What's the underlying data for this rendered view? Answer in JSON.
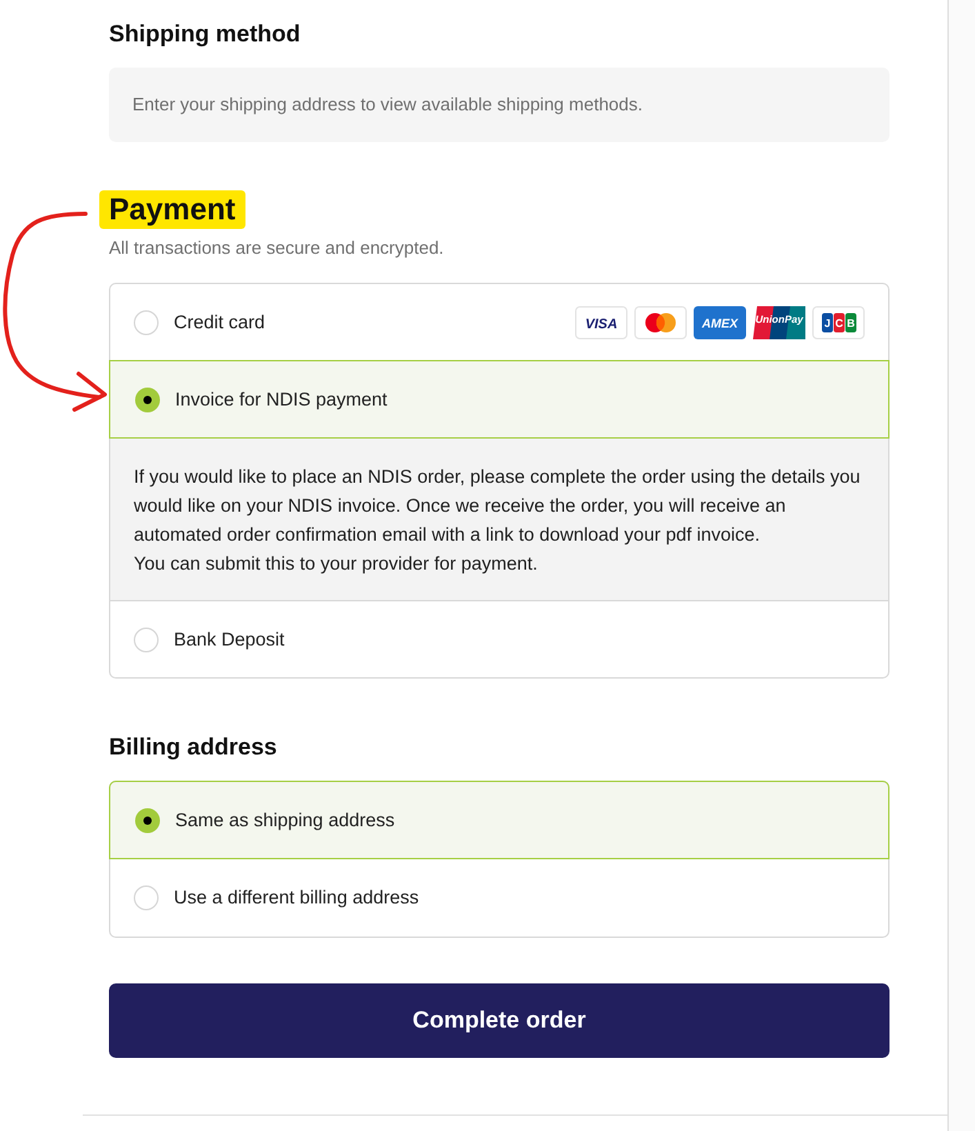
{
  "shipping_method": {
    "heading": "Shipping method",
    "notice": "Enter your shipping address to view available shipping methods."
  },
  "payment": {
    "heading": "Payment",
    "highlighted": true,
    "subtitle": "All transactions are secure and encrypted.",
    "options": [
      {
        "label": "Credit card",
        "selected": false,
        "card_logos": [
          {
            "kind": "visa",
            "text": "VISA"
          },
          {
            "kind": "mastercard"
          },
          {
            "kind": "amex",
            "text": "AMEX"
          },
          {
            "kind": "unionpay",
            "text": "UnionPay"
          },
          {
            "kind": "jcb",
            "text": "JCB"
          }
        ]
      },
      {
        "label": "Invoice for NDIS payment",
        "selected": true,
        "details": [
          "If you would like to place an NDIS order, please complete the order using the details you would like on your NDIS invoice. Once we receive the order, you will receive an automated order confirmation email with a link to download your pdf invoice.",
          "You can submit this to your provider for payment."
        ]
      },
      {
        "label": "Bank Deposit",
        "selected": false
      }
    ]
  },
  "billing_address": {
    "heading": "Billing address",
    "options": [
      {
        "label": "Same as shipping address",
        "selected": true
      },
      {
        "label": "Use a different billing address",
        "selected": false
      }
    ]
  },
  "complete_button": {
    "label": "Complete order"
  }
}
